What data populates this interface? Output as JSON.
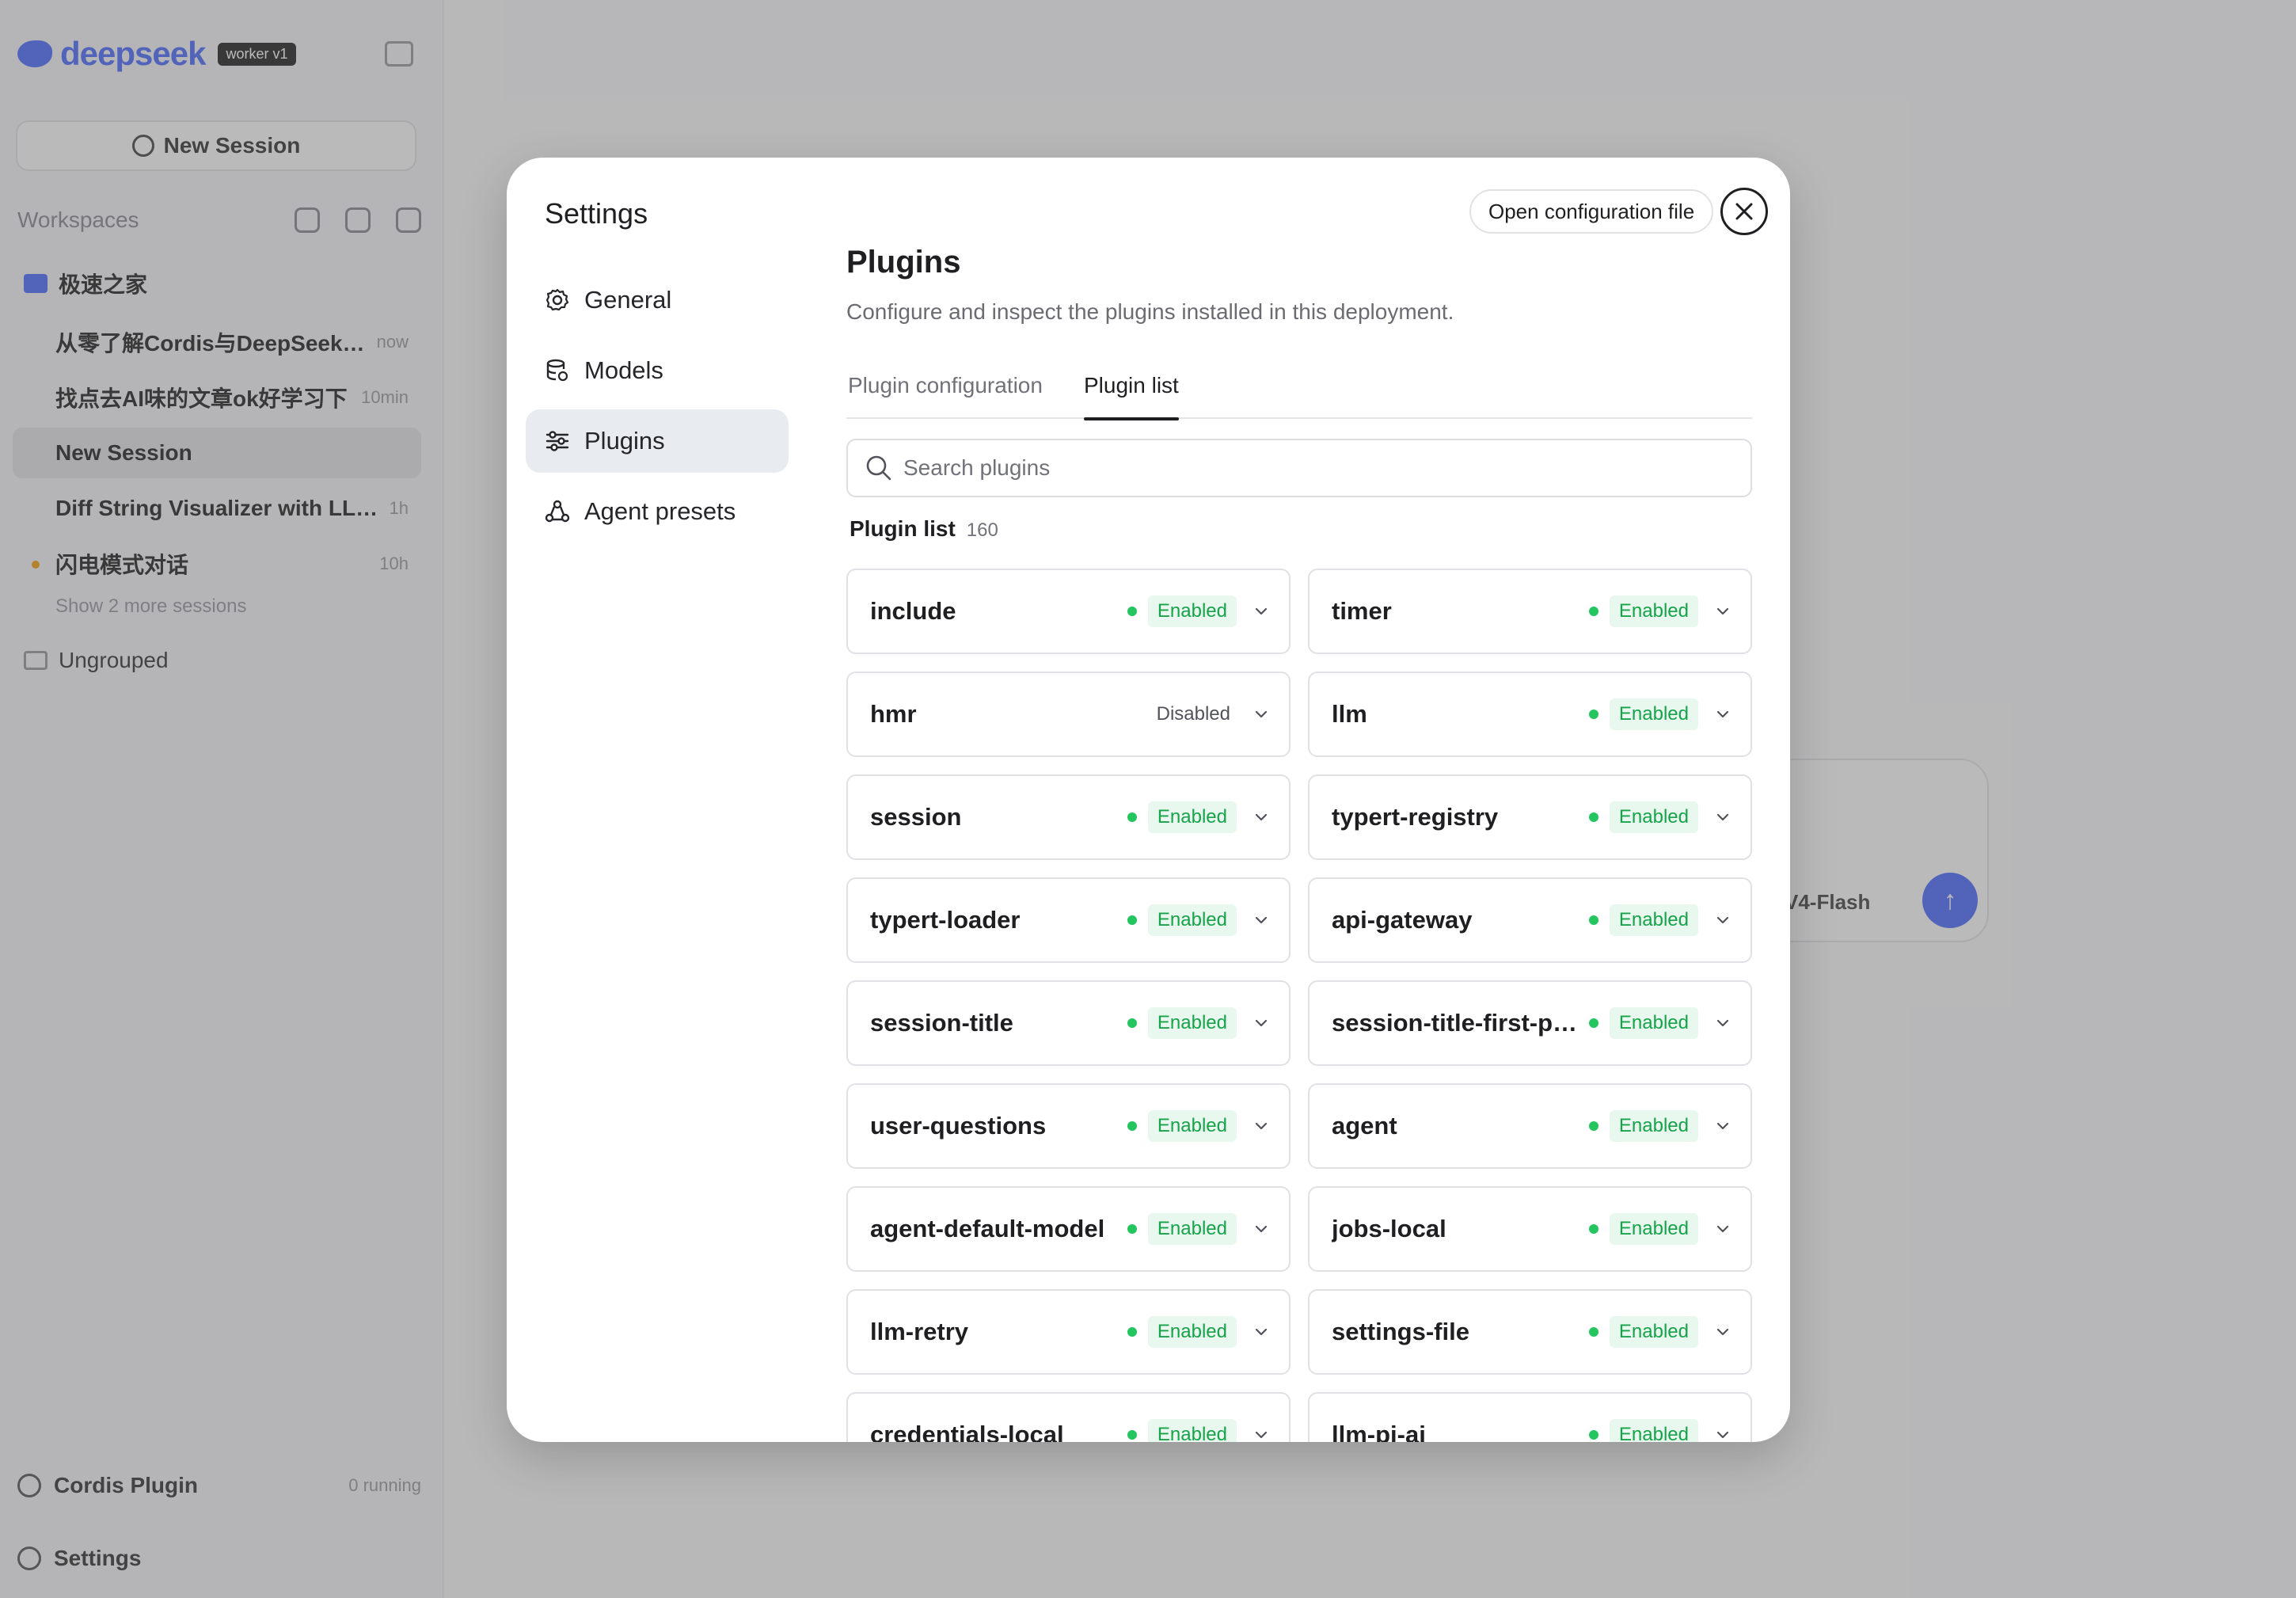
{
  "background": {
    "brand": {
      "name": "deepseek",
      "badge": "worker v1"
    },
    "new_session_label": "New Session",
    "workspaces_title": "Workspaces",
    "folder_name": "极速之家",
    "sessions": [
      {
        "title": "从零了解Cordis与DeepSeek…",
        "time": "now",
        "state": "normal"
      },
      {
        "title": "找点去AI味的文章ok好学习下",
        "time": "10min",
        "state": "normal"
      },
      {
        "title": "New Session",
        "time": "",
        "state": "active"
      },
      {
        "title": "Diff String Visualizer with LL…",
        "time": "1h",
        "state": "normal"
      },
      {
        "title": "闪电模式对话",
        "time": "10h",
        "state": "orange"
      }
    ],
    "show_more": "Show 2 more sessions",
    "ungrouped_label": "Ungrouped",
    "bottom": {
      "plugin_label": "Cordis Plugin",
      "plugin_meta": "0 running",
      "settings_label": "Settings"
    },
    "composer_model": "V4-Flash"
  },
  "modal": {
    "title": "Settings",
    "open_config_label": "Open configuration file",
    "nav": [
      {
        "label": "General",
        "icon": "gear-icon",
        "active": false
      },
      {
        "label": "Models",
        "icon": "database-icon",
        "active": false
      },
      {
        "label": "Plugins",
        "icon": "sliders-icon",
        "active": true
      },
      {
        "label": "Agent presets",
        "icon": "agent-icon",
        "active": false
      }
    ],
    "page": {
      "title": "Plugins",
      "description": "Configure and inspect the plugins installed in this deployment."
    },
    "tabs": [
      {
        "label": "Plugin configuration",
        "active": false
      },
      {
        "label": "Plugin list",
        "active": true
      }
    ],
    "search": {
      "placeholder": "Search plugins",
      "value": ""
    },
    "list": {
      "label": "Plugin list",
      "count": "160",
      "plugins": [
        {
          "name": "include",
          "status": "Enabled"
        },
        {
          "name": "timer",
          "status": "Enabled"
        },
        {
          "name": "hmr",
          "status": "Disabled"
        },
        {
          "name": "llm",
          "status": "Enabled"
        },
        {
          "name": "session",
          "status": "Enabled"
        },
        {
          "name": "typert-registry",
          "status": "Enabled"
        },
        {
          "name": "typert-loader",
          "status": "Enabled"
        },
        {
          "name": "api-gateway",
          "status": "Enabled"
        },
        {
          "name": "session-title",
          "status": "Enabled"
        },
        {
          "name": "session-title-first-prompt",
          "status": "Enabled"
        },
        {
          "name": "user-questions",
          "status": "Enabled"
        },
        {
          "name": "agent",
          "status": "Enabled"
        },
        {
          "name": "agent-default-model",
          "status": "Enabled"
        },
        {
          "name": "jobs-local",
          "status": "Enabled"
        },
        {
          "name": "llm-retry",
          "status": "Enabled"
        },
        {
          "name": "settings-file",
          "status": "Enabled"
        },
        {
          "name": "credentials-local",
          "status": "Enabled"
        },
        {
          "name": "llm-pi-ai",
          "status": "Enabled"
        }
      ]
    }
  },
  "colors": {
    "accent": "#4d6bfe",
    "enabled_text": "#16a34a",
    "enabled_bg": "#e9f8ef",
    "enabled_dot": "#22c55e"
  }
}
